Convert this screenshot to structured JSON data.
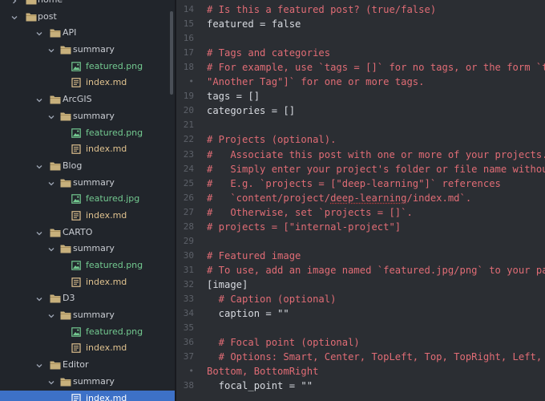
{
  "sidebar": {
    "rows": [
      {
        "label": "home",
        "type": "folder",
        "depth": 1,
        "expanded": false
      },
      {
        "label": "post",
        "type": "folder",
        "depth": 1,
        "expanded": true
      },
      {
        "label": "API",
        "type": "folder",
        "depth": 2,
        "expanded": true
      },
      {
        "label": "summary",
        "type": "folder",
        "depth": 3,
        "expanded": true
      },
      {
        "label": "featured.png",
        "type": "image",
        "depth": 4
      },
      {
        "label": "index.md",
        "type": "md",
        "depth": 4
      },
      {
        "label": "ArcGIS",
        "type": "folder",
        "depth": 2,
        "expanded": true
      },
      {
        "label": "summary",
        "type": "folder",
        "depth": 3,
        "expanded": true
      },
      {
        "label": "featured.png",
        "type": "image",
        "depth": 4
      },
      {
        "label": "index.md",
        "type": "md",
        "depth": 4
      },
      {
        "label": "Blog",
        "type": "folder",
        "depth": 2,
        "expanded": true
      },
      {
        "label": "summary",
        "type": "folder",
        "depth": 3,
        "expanded": true
      },
      {
        "label": "featured.jpg",
        "type": "image",
        "depth": 4
      },
      {
        "label": "index.md",
        "type": "md",
        "depth": 4
      },
      {
        "label": "CARTO",
        "type": "folder",
        "depth": 2,
        "expanded": true
      },
      {
        "label": "summary",
        "type": "folder",
        "depth": 3,
        "expanded": true
      },
      {
        "label": "featured.png",
        "type": "image",
        "depth": 4
      },
      {
        "label": "index.md",
        "type": "md",
        "depth": 4
      },
      {
        "label": "D3",
        "type": "folder",
        "depth": 2,
        "expanded": true
      },
      {
        "label": "summary",
        "type": "folder",
        "depth": 3,
        "expanded": true
      },
      {
        "label": "featured.png",
        "type": "image",
        "depth": 4
      },
      {
        "label": "index.md",
        "type": "md",
        "depth": 4
      },
      {
        "label": "Editor",
        "type": "folder",
        "depth": 2,
        "expanded": true
      },
      {
        "label": "summary",
        "type": "folder",
        "depth": 3,
        "expanded": true
      },
      {
        "label": "index.md",
        "type": "md",
        "depth": 4,
        "selected": true
      }
    ]
  },
  "editor": {
    "lines": [
      {
        "num": "14",
        "text": "# Is this a featured post? (true/false)",
        "kind": "comment"
      },
      {
        "num": "15",
        "text": "featured = false",
        "kind": "plain"
      },
      {
        "num": "16",
        "text": "",
        "kind": "plain"
      },
      {
        "num": "17",
        "text": "# Tags and categories",
        "kind": "comment"
      },
      {
        "num": "18",
        "text": "# For example, use `tags = []` for no tags, or the form `tags = [\"A Tag\",",
        "kind": "comment"
      },
      {
        "num": "•",
        "text": "\"Another Tag\"]` for one or more tags.",
        "kind": "comment"
      },
      {
        "num": "19",
        "text": "tags = []",
        "kind": "plain"
      },
      {
        "num": "20",
        "text": "categories = []",
        "kind": "plain"
      },
      {
        "num": "21",
        "text": "",
        "kind": "plain"
      },
      {
        "num": "22",
        "text": "# Projects (optional).",
        "kind": "comment"
      },
      {
        "num": "23",
        "text": "#   Associate this post with one or more of your projects.",
        "kind": "comment"
      },
      {
        "num": "24",
        "text": "#   Simply enter your project's folder or file name without extension.",
        "kind": "comment"
      },
      {
        "num": "25",
        "text": "#   E.g. `projects = [\"deep-learning\"]` references",
        "kind": "comment"
      },
      {
        "num": "26",
        "text": "#   `content/project/deep-learning/index.md`.",
        "kind": "comment",
        "underline": "deep-learning"
      },
      {
        "num": "27",
        "text": "#   Otherwise, set `projects = []`.",
        "kind": "comment"
      },
      {
        "num": "28",
        "text": "# projects = [\"internal-project\"]",
        "kind": "comment"
      },
      {
        "num": "29",
        "text": "",
        "kind": "plain"
      },
      {
        "num": "30",
        "text": "# Featured image",
        "kind": "comment"
      },
      {
        "num": "31",
        "text": "# To use, add an image named `featured.jpg/png` to your page's folder.",
        "kind": "comment"
      },
      {
        "num": "32",
        "text": "[image]",
        "kind": "plain"
      },
      {
        "num": "33",
        "text": "  # Caption (optional)",
        "kind": "comment"
      },
      {
        "num": "34",
        "text": "  caption = \"\"",
        "kind": "plain"
      },
      {
        "num": "35",
        "text": "",
        "kind": "plain"
      },
      {
        "num": "36",
        "text": "  # Focal point (optional)",
        "kind": "comment"
      },
      {
        "num": "37",
        "text": "  # Options: Smart, Center, TopLeft, Top, TopRight, Left, Right, BottomLeft,",
        "kind": "comment"
      },
      {
        "num": "•",
        "text": "Bottom, BottomRight",
        "kind": "comment"
      },
      {
        "num": "38",
        "text": "  focal_point = \"\"",
        "kind": "plain"
      }
    ]
  },
  "colors": {
    "comment": "#e06c75",
    "plain": "#d7dae0",
    "folder": "#e2c08d",
    "image_file": "#73c990",
    "md_file": "#e0c28f",
    "selection": "#3d71c7"
  }
}
